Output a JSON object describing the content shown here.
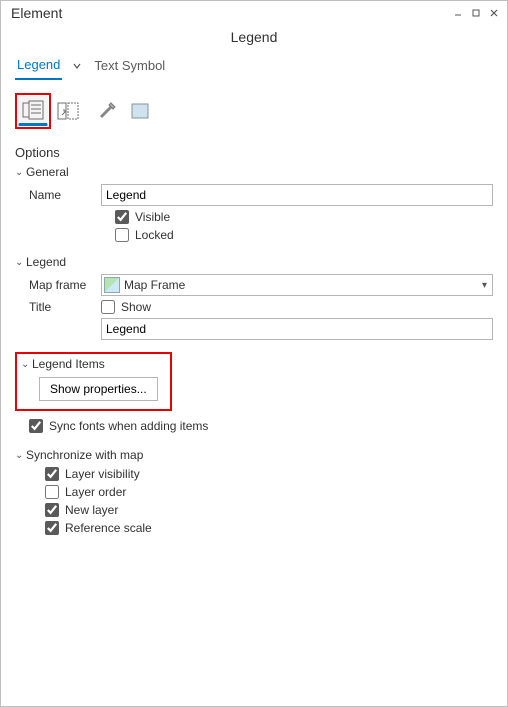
{
  "panel": {
    "title": "Element",
    "subtitle": "Legend"
  },
  "tabs": {
    "legend": "Legend",
    "textSymbol": "Text Symbol"
  },
  "optionsTitle": "Options",
  "sections": {
    "general": {
      "title": "General",
      "nameLabel": "Name",
      "nameValue": "Legend",
      "visible": "Visible",
      "locked": "Locked"
    },
    "legend": {
      "title": "Legend",
      "mapFrameLabel": "Map frame",
      "mapFrameValue": "Map Frame",
      "titleLabel": "Title",
      "show": "Show",
      "titleValue": "Legend"
    },
    "legendItems": {
      "title": "Legend Items",
      "showProps": "Show properties..."
    },
    "syncFonts": "Sync fonts when adding items",
    "syncMap": {
      "title": "Synchronize with map",
      "layerVisibility": "Layer visibility",
      "layerOrder": "Layer order",
      "newLayer": "New layer",
      "referenceScale": "Reference scale"
    }
  }
}
